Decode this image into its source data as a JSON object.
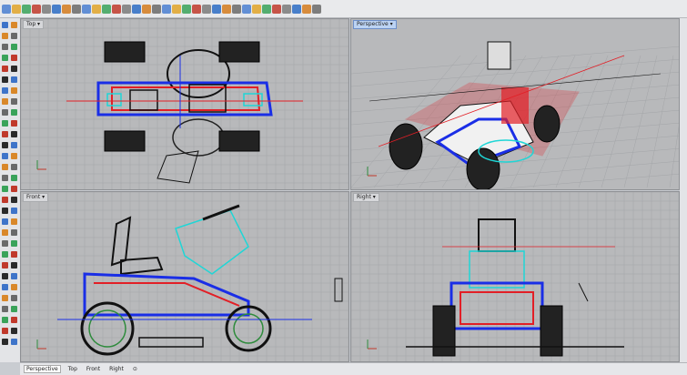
{
  "viewports": {
    "top": {
      "label": "Top"
    },
    "perspective": {
      "label": "Perspective"
    },
    "front": {
      "label": "Front"
    },
    "right": {
      "label": "Right"
    }
  },
  "bottom_tabs": [
    "Perspective",
    "Top",
    "Front",
    "Right"
  ],
  "bottom_tab_extra": "⊙",
  "icons": {
    "viewport_menu": "chevron-down-icon",
    "toolbar": [
      "new-file-icon",
      "open-icon",
      "save-icon",
      "print-icon",
      "save-small-icon",
      "cut-icon",
      "copy-icon",
      "paste-icon",
      "undo-icon",
      "pan-icon",
      "rotate-icon",
      "zoom-window-icon",
      "zoom-extents-icon",
      "zoom-selected-icon",
      "select-icon",
      "grid-icon",
      "layers-icon",
      "properties-icon",
      "point-icon",
      "curve-icon",
      "surface-icon",
      "solid-icon",
      "mesh-icon",
      "render-icon",
      "shaded-icon",
      "sphere-icon",
      "rendered-icon",
      "camera-icon",
      "light-icon",
      "bulb-icon",
      "material-icon",
      "help-icon"
    ]
  },
  "colors": {
    "viewport_bg": "#b8b9bb",
    "grid": "#a3a5a8",
    "x_axis": "#c0392b",
    "y_axis": "#2e8b3c",
    "wire_blue": "#1a2ee6",
    "wire_red": "#e21f26",
    "wire_cyan": "#1fd6d6",
    "wire_black": "#111111"
  }
}
